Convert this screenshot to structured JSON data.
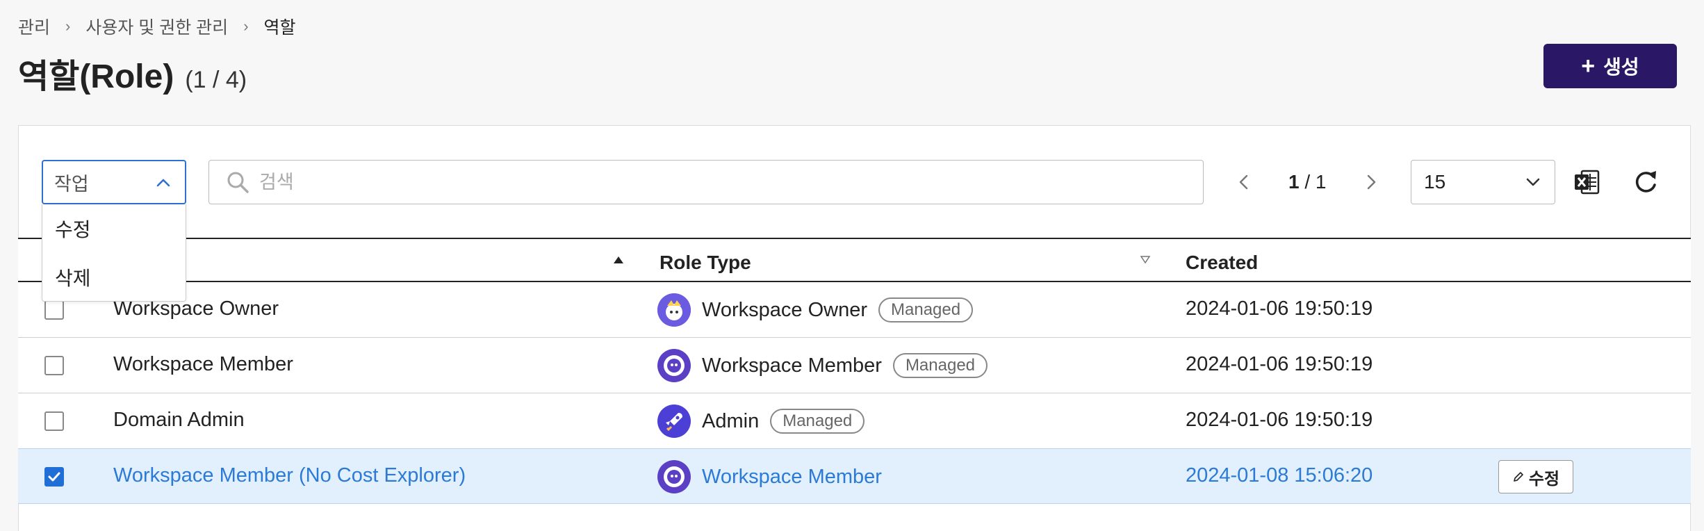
{
  "breadcrumb": {
    "items": [
      "관리",
      "사용자 및 권한 관리",
      "역할"
    ]
  },
  "title": "역할(Role)",
  "count": "(1 / 4)",
  "create_button": "생성",
  "toolbar": {
    "action_placeholder": "작업",
    "action_menu": [
      "수정",
      "삭제"
    ],
    "search_placeholder": "검색",
    "pager": {
      "current": "1",
      "total": "1",
      "separator": "/"
    },
    "page_size": "15"
  },
  "table": {
    "columns": {
      "role_type": "Role Type",
      "created": "Created"
    },
    "rows": [
      {
        "name": "Workspace Owner",
        "role_type": "Workspace Owner",
        "badge": "Managed",
        "created": "2024-01-06 19:50:19",
        "selected": false
      },
      {
        "name": "Workspace Member",
        "role_type": "Workspace Member",
        "badge": "Managed",
        "created": "2024-01-06 19:50:19",
        "selected": false
      },
      {
        "name": "Domain Admin",
        "role_type": "Admin",
        "badge": "Managed",
        "created": "2024-01-06 19:50:19",
        "selected": false
      },
      {
        "name": "Workspace Member (No Cost Explorer)",
        "role_type": "Workspace Member",
        "badge": "",
        "created": "2024-01-08 15:06:20",
        "selected": true,
        "edit_label": "수정"
      }
    ]
  },
  "colors": {
    "brand": "#2a1765",
    "accent": "#2b7bd6",
    "selected_row": "#e2effc",
    "checkbox": "#1f6fd6"
  }
}
